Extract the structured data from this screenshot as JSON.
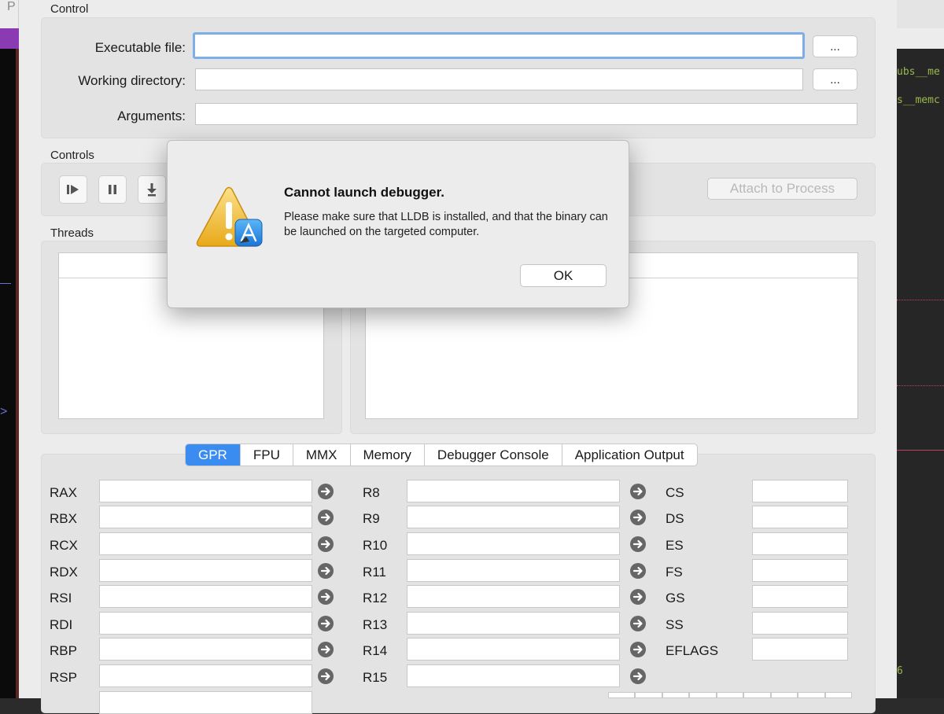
{
  "background": {
    "left_char": "P",
    "code_lines": [
      "ubs__me",
      "s__memc"
    ],
    "line_number": "6",
    "accent": "#8a3bb3"
  },
  "control": {
    "group_title": "Control",
    "executable_label": "Executable file:",
    "executable_value": "",
    "working_dir_label": "Working directory:",
    "working_dir_value": "",
    "arguments_label": "Arguments:",
    "arguments_value": "",
    "browse_label": "..."
  },
  "controls": {
    "group_title": "Controls",
    "attach_label": "Attach to Process",
    "icons": [
      "play-step-icon",
      "pause-icon",
      "step-into-icon"
    ]
  },
  "threads": {
    "group_title": "Threads"
  },
  "tabs": {
    "items": [
      "GPR",
      "FPU",
      "MMX",
      "Memory",
      "Debugger Console",
      "Application Output"
    ],
    "active": "GPR",
    "active_color": "#3a8cf0"
  },
  "registers": {
    "col1": [
      "RAX",
      "RBX",
      "RCX",
      "RDX",
      "RSI",
      "RDI",
      "RBP",
      "RSP"
    ],
    "col2": [
      "R8",
      "R9",
      "R10",
      "R11",
      "R12",
      "R13",
      "R14",
      "R15"
    ],
    "col3": [
      "CS",
      "DS",
      "ES",
      "FS",
      "GS",
      "SS",
      "EFLAGS"
    ]
  },
  "dialog": {
    "title": "Cannot launch debugger.",
    "message": "Please make sure that LLDB is installed, and that the binary can be launched on the targeted computer.",
    "ok_label": "OK",
    "icon": "warning-icon"
  }
}
